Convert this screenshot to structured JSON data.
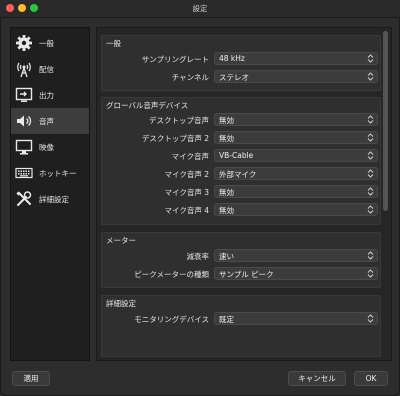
{
  "window": {
    "title": "設定"
  },
  "sidebar": {
    "items": [
      {
        "label": "一般",
        "icon": "gear-icon"
      },
      {
        "label": "配信",
        "icon": "broadcast-tower-icon"
      },
      {
        "label": "出力",
        "icon": "output-icon"
      },
      {
        "label": "音声",
        "icon": "speaker-icon",
        "active": true
      },
      {
        "label": "映像",
        "icon": "monitor-icon"
      },
      {
        "label": "ホットキー",
        "icon": "keyboard-icon"
      },
      {
        "label": "詳細設定",
        "icon": "tools-icon"
      }
    ]
  },
  "groups": [
    {
      "title": "一般",
      "rows": [
        {
          "label": "サンプリングレート",
          "value": "48 kHz"
        },
        {
          "label": "チャンネル",
          "value": "ステレオ"
        }
      ]
    },
    {
      "title": "グローバル音声デバイス",
      "rows": [
        {
          "label": "デスクトップ音声",
          "value": "無効"
        },
        {
          "label": "デスクトップ音声 2",
          "value": "無効"
        },
        {
          "label": "マイク音声",
          "value": "VB-Cable"
        },
        {
          "label": "マイク音声 2",
          "value": "外部マイク"
        },
        {
          "label": "マイク音声 3",
          "value": "無効"
        },
        {
          "label": "マイク音声 4",
          "value": "無効"
        }
      ]
    },
    {
      "title": "メーター",
      "rows": [
        {
          "label": "減衰率",
          "value": "速い"
        },
        {
          "label": "ピークメーターの種類",
          "value": "サンプル ピーク"
        }
      ]
    },
    {
      "title": "詳細設定",
      "rows": [
        {
          "label": "モニタリングデバイス",
          "value": "既定"
        }
      ]
    }
  ],
  "footer": {
    "apply": "適用",
    "cancel": "キャンセル",
    "ok": "OK"
  }
}
